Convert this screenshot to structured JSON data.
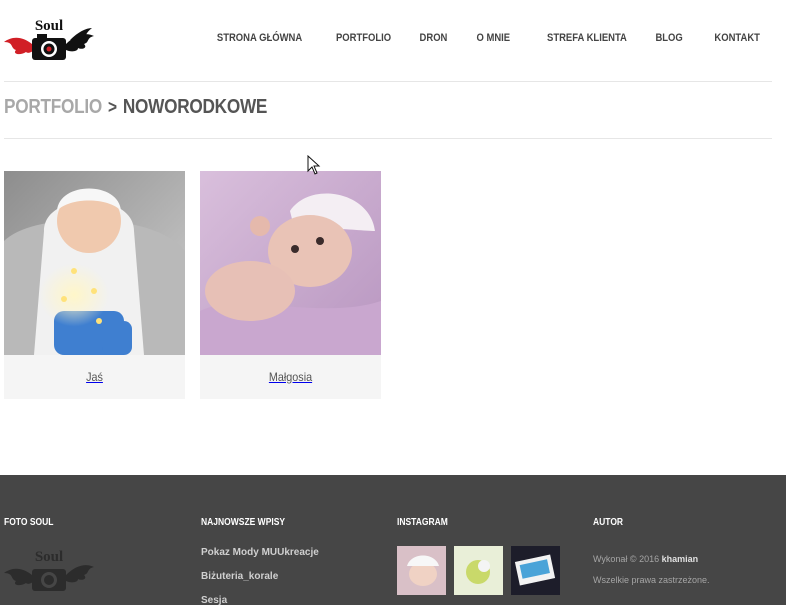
{
  "brand": {
    "logo_text": "Soul"
  },
  "nav": {
    "items": [
      {
        "label": "STRONA GŁÓWNA"
      },
      {
        "label": "PORTFOLIO"
      },
      {
        "label": "DRON"
      },
      {
        "label": "O MNIE"
      },
      {
        "label": "STREFA KLIENTA"
      },
      {
        "label": "BLOG"
      },
      {
        "label": "KONTAKT"
      }
    ]
  },
  "breadcrumb": {
    "parent": "PORTFOLIO",
    "separator": ">",
    "current": "NOWORODKOWE"
  },
  "gallery": {
    "items": [
      {
        "caption": "Jaś"
      },
      {
        "caption": "Małgosia"
      }
    ]
  },
  "footer": {
    "col1_title": "FOTO SOUL",
    "col2_title": "NAJNOWSZE WPISY",
    "col3_title": "INSTAGRAM",
    "col4_title": "AUTOR",
    "posts": [
      "Pokaz Mody MUUkreacje",
      "Biżuteria_korale",
      "Sesja"
    ],
    "author_prefix": "Wykonał © 2016",
    "author_name": "khamian",
    "rights": "Wszelkie prawa zastrzeżone."
  },
  "colors": {
    "footer_bg": "#464646",
    "logo_red": "#d11f26",
    "accent_text": "#555555"
  }
}
